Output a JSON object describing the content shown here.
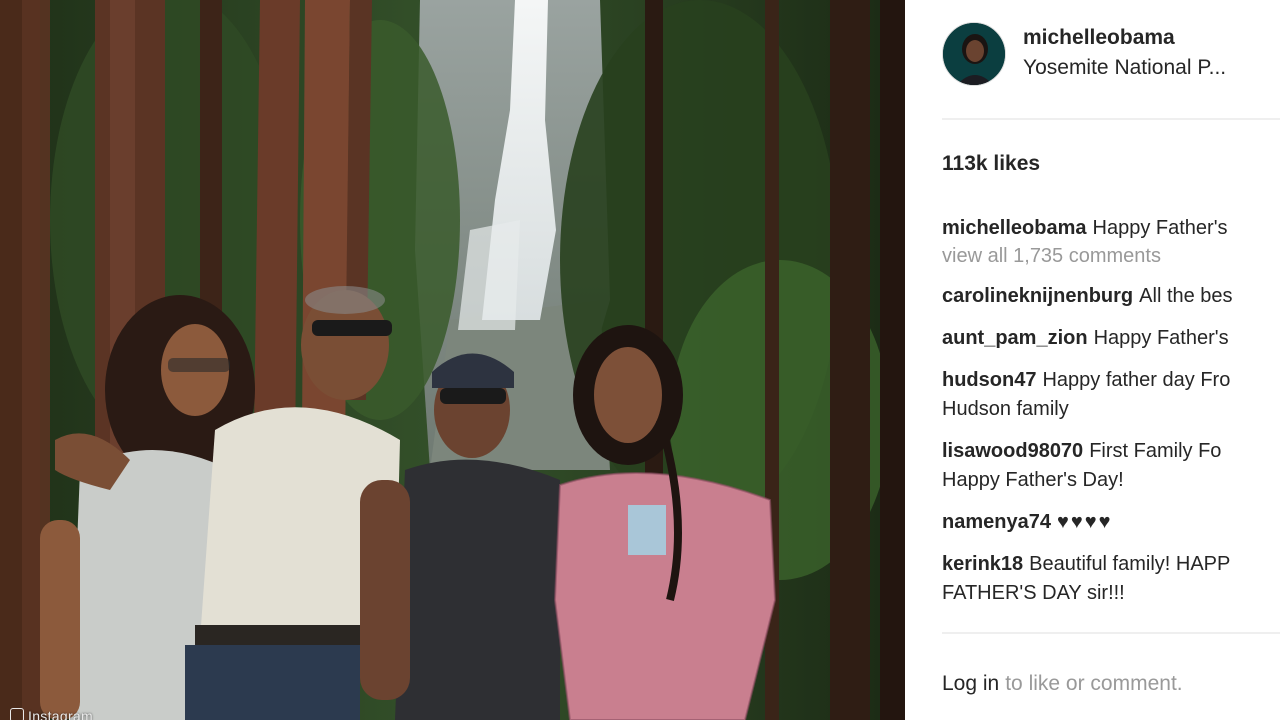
{
  "photo": {
    "alt_icon": "family-photo-yosemite",
    "watermark": "Instagram"
  },
  "post": {
    "username": "michelleobama",
    "location": "Yosemite National P...",
    "likes": "113k likes",
    "caption": {
      "user": "michelleobama",
      "text": "Happy Father's"
    },
    "view_all": "view all 1,735 comments",
    "comments": [
      {
        "user": "carolineknijnenburg",
        "lines": [
          "All the bes"
        ]
      },
      {
        "user": "aunt_pam_zion",
        "lines": [
          "Happy Father's"
        ]
      },
      {
        "user": "hudson47",
        "lines": [
          "Happy father day Fro",
          "Hudson family"
        ]
      },
      {
        "user": "lisawood98070",
        "lines": [
          "First Family Fo",
          "Happy Father's Day!"
        ]
      },
      {
        "user": "namenya74",
        "lines": [
          "♥♥♥♥"
        ]
      },
      {
        "user": "kerink18",
        "lines": [
          "Beautiful family! HAPP",
          "FATHER'S DAY sir!!!"
        ]
      }
    ],
    "footer": {
      "login": "Log in",
      "rest": "to like or comment."
    }
  },
  "colors": {
    "text": "#262626",
    "muted": "#999999",
    "divider": "#efefef"
  }
}
